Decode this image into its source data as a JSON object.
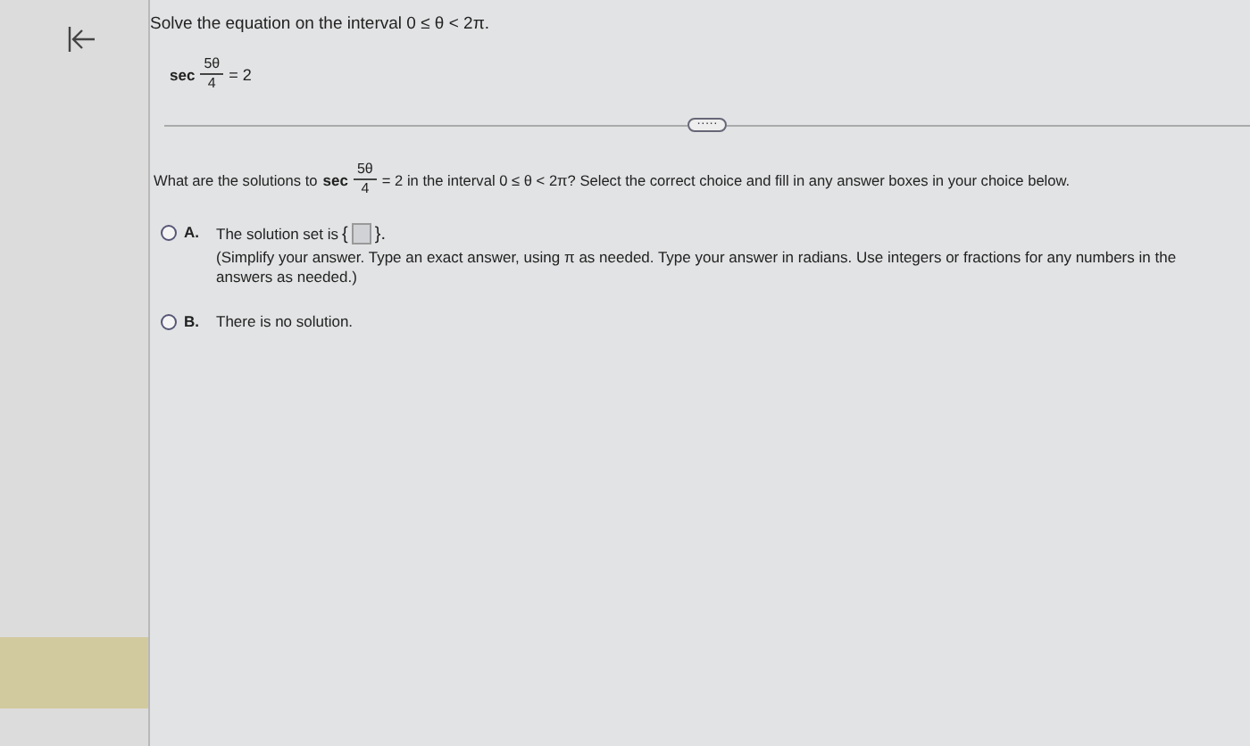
{
  "problem": {
    "instruction": "Solve the equation on the interval 0 ≤ θ < 2π.",
    "equation": {
      "function": "sec",
      "numerator": "5θ",
      "denominator": "4",
      "rhs": "= 2"
    }
  },
  "more_button": "·····",
  "question": {
    "before": "What are the solutions to",
    "function": "sec",
    "numerator": "5θ",
    "denominator": "4",
    "after": "= 2 in the interval 0 ≤ θ < 2π?  Select the correct choice and fill in any answer boxes in your choice below."
  },
  "choices": [
    {
      "kind": "answer_set",
      "letter": "A.",
      "selected": false,
      "text": "The solution set is",
      "open": "{",
      "close": "}.",
      "note": "(Simplify your answer.  Type an exact answer, using π as needed.  Type your answer in radians.  Use integers or fractions for any numbers in the answers as needed.)"
    },
    {
      "kind": "plain",
      "letter": "B.",
      "selected": false,
      "text": "There is no solution."
    }
  ]
}
